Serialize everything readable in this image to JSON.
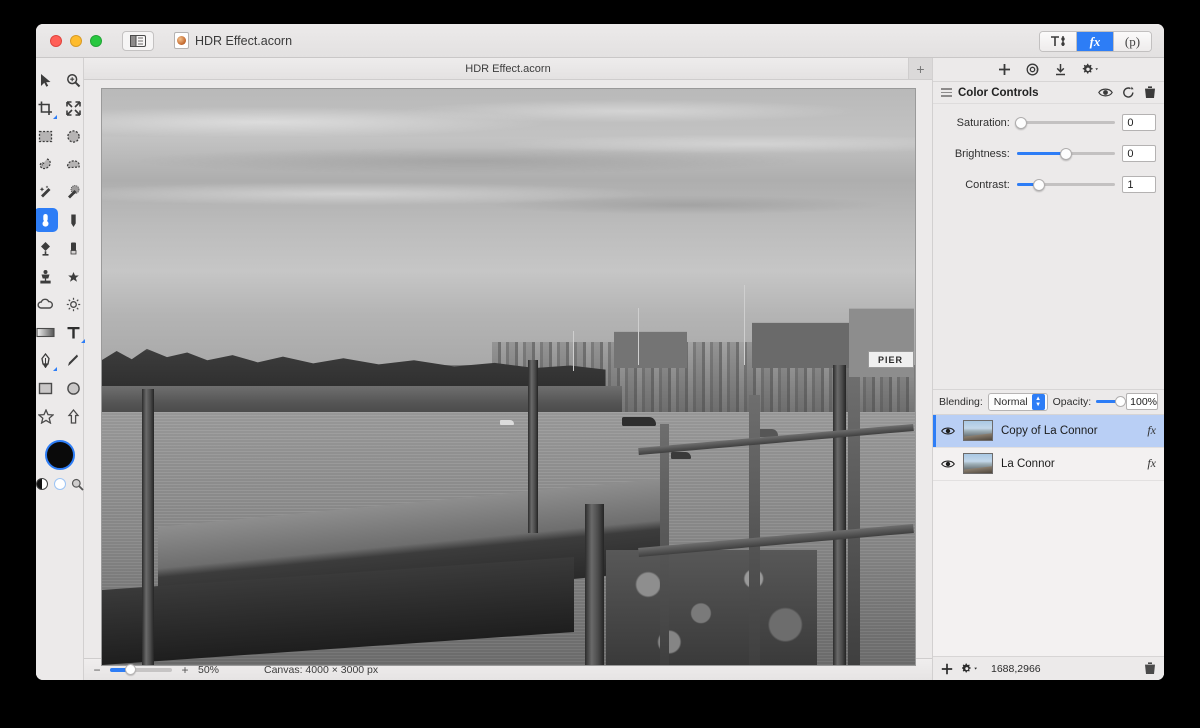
{
  "window": {
    "document_title": "HDR Effect.acorn",
    "tab_label": "HDR Effect.acorn",
    "tab_add_label": "+"
  },
  "titlebar": {
    "segmented": [
      {
        "name": "tools-inspector",
        "label": ""
      },
      {
        "name": "fx-inspector",
        "label": "fx",
        "active": true
      },
      {
        "name": "palette-inspector",
        "label": "(p)"
      }
    ]
  },
  "tools": [
    {
      "name": "move-tool",
      "icon": "arrow-cursor-icon",
      "selected": false
    },
    {
      "name": "zoom-tool",
      "icon": "magnifier-plus-icon",
      "selected": false
    },
    {
      "name": "crop-tool",
      "icon": "crop-icon",
      "selected": false,
      "submenu": true
    },
    {
      "name": "transform-tool",
      "icon": "move-arrows-icon",
      "selected": false
    },
    {
      "name": "rectangular-select-tool",
      "icon": "marquee-rect-icon",
      "selected": false
    },
    {
      "name": "elliptical-select-tool",
      "icon": "marquee-ellipse-icon",
      "selected": false
    },
    {
      "name": "lasso-tool",
      "icon": "lasso-icon",
      "selected": false
    },
    {
      "name": "polygon-lasso-tool",
      "icon": "polygon-lasso-icon",
      "selected": false
    },
    {
      "name": "magic-wand-tool",
      "icon": "magic-wand-icon",
      "selected": false
    },
    {
      "name": "instant-alpha-tool",
      "icon": "instant-alpha-icon",
      "selected": false
    },
    {
      "name": "bloat-tool",
      "icon": "bloat-icon",
      "selected": true
    },
    {
      "name": "pencil-tool",
      "icon": "pencil-icon",
      "selected": false
    },
    {
      "name": "paint-bucket-tool",
      "icon": "paint-bucket-icon",
      "selected": false
    },
    {
      "name": "eraser-tool",
      "icon": "eraser-icon",
      "selected": false
    },
    {
      "name": "clone-stamp-tool",
      "icon": "clone-stamp-icon",
      "selected": false
    },
    {
      "name": "smudge-tool",
      "icon": "smudge-icon",
      "selected": false
    },
    {
      "name": "blur-tool",
      "icon": "cloud-icon",
      "selected": false
    },
    {
      "name": "dodge-tool",
      "icon": "sun-icon",
      "selected": false
    },
    {
      "name": "gradient-tool",
      "icon": "gradient-icon",
      "selected": false
    },
    {
      "name": "text-tool",
      "icon": "text-t-icon",
      "selected": false,
      "submenu": true
    },
    {
      "name": "pen-tool",
      "icon": "pen-nib-icon",
      "selected": false,
      "submenu": true
    },
    {
      "name": "line-tool",
      "icon": "line-icon",
      "selected": false
    },
    {
      "name": "rectangle-shape-tool",
      "icon": "rectangle-icon",
      "selected": false
    },
    {
      "name": "ellipse-shape-tool",
      "icon": "ellipse-icon",
      "selected": false
    },
    {
      "name": "star-shape-tool",
      "icon": "star-icon",
      "selected": false
    },
    {
      "name": "arrow-shape-tool",
      "icon": "arrow-up-icon",
      "selected": false
    }
  ],
  "color_well": {
    "foreground": "#0a0a0a",
    "selection_ring": "#2d7df6"
  },
  "mini_tools": [
    {
      "name": "swap-colors-control",
      "icon": "half-circle-icon"
    },
    {
      "name": "reset-colors-control",
      "icon": "empty-circle-icon"
    },
    {
      "name": "color-picker-control",
      "icon": "magnifier-icon"
    }
  ],
  "statusbar": {
    "zoom_minus": "−",
    "zoom_plus": "+",
    "zoom_percent": "50%",
    "canvas_size": "Canvas: 4000 × 3000 px"
  },
  "inspector": {
    "toolbar_icons": [
      {
        "name": "add-filter-button",
        "icon": "plus-icon"
      },
      {
        "name": "filter-target-button",
        "icon": "target-icon"
      },
      {
        "name": "download-preset-button",
        "icon": "download-icon"
      },
      {
        "name": "filter-settings-button",
        "icon": "gear-dropdown-icon"
      }
    ],
    "filter": {
      "title": "Color Controls",
      "head_icons": [
        {
          "name": "toggle-visibility-icon",
          "icon": "eye-icon"
        },
        {
          "name": "reset-filter-icon",
          "icon": "reset-arrow-icon"
        },
        {
          "name": "delete-filter-icon",
          "icon": "trash-icon"
        }
      ],
      "controls": [
        {
          "name": "saturation",
          "label": "Saturation:",
          "value": "0",
          "fill_pct": 0,
          "knob_pct": 0
        },
        {
          "name": "brightness",
          "label": "Brightness:",
          "value": "0",
          "fill_pct": 50,
          "knob_pct": 50
        },
        {
          "name": "contrast",
          "label": "Contrast:",
          "value": "1",
          "fill_pct": 22,
          "knob_pct": 22
        }
      ]
    },
    "blending": {
      "label": "Blending:",
      "mode": "Normal",
      "opacity_label": "Opacity:",
      "opacity_value": "100%"
    },
    "layers": [
      {
        "name": "Copy of La Connor",
        "selected": true,
        "visible": true,
        "fx": "fx"
      },
      {
        "name": "La Connor",
        "selected": false,
        "visible": true,
        "fx": "fx"
      }
    ],
    "layers_footer": {
      "add_icon": "plus-icon",
      "settings_icon": "gear-dropdown-icon",
      "coords": "1688,2966",
      "delete_icon": "trash-icon"
    }
  },
  "canvas_image": {
    "description": "Black and white photograph of a harbor waterfront with a wooden dock, pilings, boats, and buildings",
    "sign_text": "PIER"
  }
}
